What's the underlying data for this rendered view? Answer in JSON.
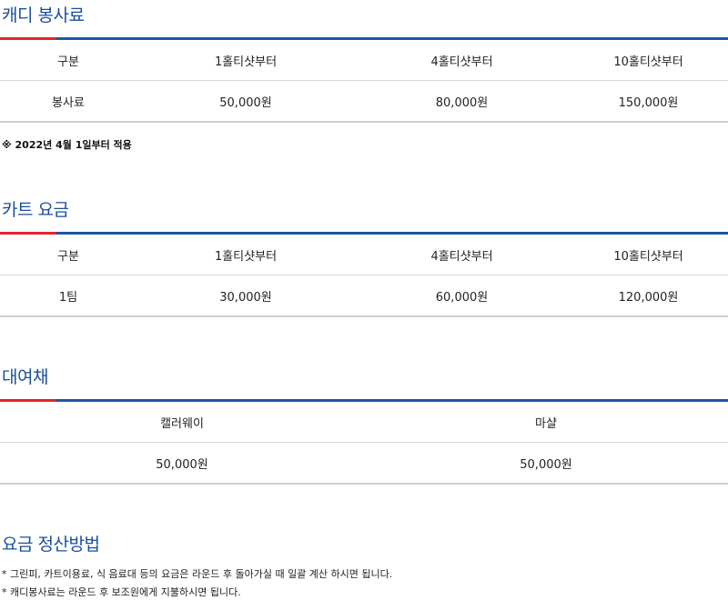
{
  "caddie": {
    "title": "캐디 봉사료",
    "headers": [
      "구분",
      "1홀티샷부터",
      "4홀티샷부터",
      "10홀티샷부터"
    ],
    "row": [
      "봉사료",
      "50,000원",
      "80,000원",
      "150,000원"
    ],
    "note": "※ 2022년 4월 1일부터 적용"
  },
  "cart": {
    "title": "카트 요금",
    "headers": [
      "구분",
      "1홀티샷부터",
      "4홀티샷부터",
      "10홀티샷부터"
    ],
    "row": [
      "1팀",
      "30,000원",
      "60,000원",
      "120,000원"
    ]
  },
  "rental": {
    "title": "대여채",
    "headers": [
      "캘러웨이",
      "마샬"
    ],
    "row": [
      "50,000원",
      "50,000원"
    ]
  },
  "payment": {
    "title": "요금 정산방법",
    "lines": [
      "* 그린피, 카트이용료, 식 음료대 등의 요금은 라운드 후 돌아가실 때 일괄 계산 하시면 됩니다.",
      "* 캐디봉사료는 라운드 후 보조원에게 지불하시면 됩니다."
    ]
  }
}
